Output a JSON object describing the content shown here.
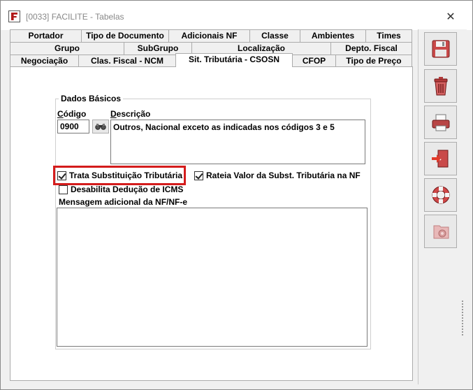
{
  "window": {
    "title": "[0033] FACILITE - Tabelas",
    "close_symbol": "✕"
  },
  "tabs": {
    "row1": [
      "Portador",
      "Tipo de Documento",
      "Adicionais NF",
      "Classe",
      "Ambientes",
      "Times"
    ],
    "row2": [
      "Grupo",
      "SubGrupo",
      "Localização",
      "Depto. Fiscal"
    ],
    "row3": [
      "Negociação",
      "Clas. Fiscal - NCM",
      "Sit. Tributária - CSOSN",
      "CFOP",
      "Tipo de Preço"
    ],
    "active": "Sit. Tributária - CSOSN"
  },
  "form": {
    "group_title": "Dados Básicos",
    "codigo_label": "Código",
    "descricao_label": "Descrição",
    "codigo_value": "0900",
    "descricao_value": "Outros, Nacional exceto as indicadas nos códigos 3 e 5",
    "trata_st_label": "Trata Substituição Tributária",
    "trata_st_checked": true,
    "rateia_label": "Rateia Valor da Subst. Tributária na NF",
    "rateia_checked": true,
    "desabilita_label": "Desabilita Dedução de ICMS",
    "desabilita_checked": false,
    "mensagem_label": "Mensagem adicional da NF/NF-e",
    "mensagem_value": ""
  },
  "toolbar": {
    "buttons": [
      "save-icon",
      "delete-icon",
      "print-icon",
      "exit-icon",
      "help-icon",
      "settings-icon"
    ]
  },
  "colors": {
    "highlight": "#d41c1c",
    "accent_red": "#c62828"
  }
}
